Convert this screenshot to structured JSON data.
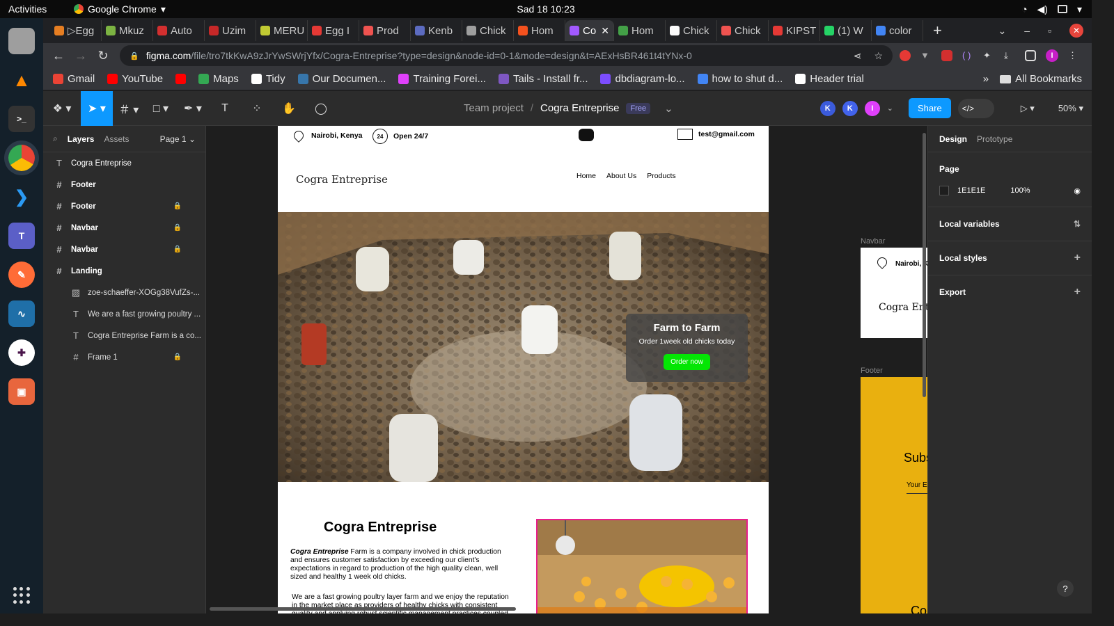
{
  "system": {
    "activities": "Activities",
    "app_name": "Google Chrome",
    "clock": "Sad 18  10:23"
  },
  "dock": [
    "Files",
    "VLC",
    "Terminal",
    "Chrome",
    "VS Code",
    "Teams",
    "Postman",
    "Wireshark",
    "Slack",
    "Impress"
  ],
  "tabs": [
    {
      "label": "▷Egg",
      "color": "#e67e22"
    },
    {
      "label": "Mkuz",
      "color": "#7cb342"
    },
    {
      "label": "Auto",
      "color": "#d32f2f"
    },
    {
      "label": "Uzim",
      "color": "#c62828"
    },
    {
      "label": "MERU",
      "color": "#c0ca33"
    },
    {
      "label": "Egg I",
      "color": "#e53935"
    },
    {
      "label": "Prod",
      "color": "#ef5350"
    },
    {
      "label": "Kenb",
      "color": "#5c6bc0"
    },
    {
      "label": "Chick",
      "color": "#9e9e9e"
    },
    {
      "label": "Hom",
      "color": "#f4511e"
    },
    {
      "label": "Co",
      "color": "#a259ff",
      "active": true
    },
    {
      "label": "Hom",
      "color": "#43a047"
    },
    {
      "label": "Chick",
      "color": "#fafafa"
    },
    {
      "label": "Chick",
      "color": "#ef5350"
    },
    {
      "label": "KIPST",
      "color": "#e53935"
    },
    {
      "label": "(1) W",
      "color": "#25d366"
    },
    {
      "label": "color",
      "color": "#4285f4"
    }
  ],
  "address": {
    "host": "figma.com",
    "path": "/file/tro7tkKwA9zJrYwSWrjYfx/Cogra-Entreprise?type=design&node-id=0-1&mode=design&t=AExHsBR461t4tYNx-0"
  },
  "bookmarks": [
    {
      "label": "Gmail",
      "color": "#ea4335"
    },
    {
      "label": "YouTube",
      "color": "#ff0000"
    },
    {
      "label": "",
      "color": "#ff0000"
    },
    {
      "label": "Maps",
      "color": "#34a853"
    },
    {
      "label": "Tidy",
      "color": "#ffffff"
    },
    {
      "label": "Our Documen...",
      "color": "#3776ab"
    },
    {
      "label": "Training Forei...",
      "color": "#e040fb"
    },
    {
      "label": "Tails - Install fr...",
      "color": "#7e57c2"
    },
    {
      "label": "dbdiagram-lo...",
      "color": "#7c4dff"
    },
    {
      "label": "how to shut d...",
      "color": "#4285f4"
    },
    {
      "label": "Header trial",
      "color": "#ffffff"
    }
  ],
  "bookmarks_all": "All Bookmarks",
  "figma": {
    "team": "Team project",
    "file": "Cogra Entreprise",
    "plan": "Free",
    "avatars": [
      {
        "letter": "K",
        "color": "#3b5bdb"
      },
      {
        "letter": "K",
        "color": "#4263eb"
      },
      {
        "letter": "I",
        "color": "#e040fb"
      }
    ],
    "share": "Share",
    "zoom": "50%"
  },
  "layers_panel": {
    "tab_layers": "Layers",
    "tab_assets": "Assets",
    "page": "Page 1",
    "items": [
      {
        "name": "Cogra Entreprise",
        "icon": "T",
        "level": 0,
        "bold": false,
        "locked": false
      },
      {
        "name": "Footer",
        "icon": "#",
        "level": 0,
        "bold": true,
        "locked": false
      },
      {
        "name": "Footer",
        "icon": "#",
        "level": 0,
        "bold": true,
        "locked": true
      },
      {
        "name": "Navbar",
        "icon": "#",
        "level": 0,
        "bold": true,
        "locked": true
      },
      {
        "name": "Navbar",
        "icon": "#",
        "level": 0,
        "bold": true,
        "locked": true
      },
      {
        "name": "Landing",
        "icon": "#",
        "level": 0,
        "bold": true,
        "locked": false
      },
      {
        "name": "zoe-schaeffer-XOGg38VufZs-...",
        "icon": "▨",
        "level": 1,
        "bold": false,
        "locked": false
      },
      {
        "name": "We are a fast growing poultry ...",
        "icon": "T",
        "level": 1,
        "bold": false,
        "locked": false
      },
      {
        "name": "Cogra Entreprise Farm is a co...",
        "icon": "T",
        "level": 1,
        "bold": false,
        "locked": false
      },
      {
        "name": "Frame 1",
        "icon": "#",
        "level": 1,
        "bold": false,
        "locked": true
      }
    ]
  },
  "canvas": {
    "contact": {
      "location": "Nairobi, Kenya",
      "hours": "Open 24/7",
      "hours_badge": "24",
      "email": "test@gmail.com"
    },
    "brand": "Cogra Entreprise",
    "nav": [
      "Home",
      "About Us",
      "Products"
    ],
    "hero": {
      "title": "Farm to Farm",
      "subtitle": "Order 1week old chicks today",
      "cta": "Order now"
    },
    "about": {
      "title": "Cogra Entreprise",
      "p1_em": "Cogra Entreprise",
      "p1_rest": " Farm is a company involved in chick production and ensures customer satisfaction by exceeding our client's expectations in regard to production of the high quality clean, well sized and healthy 1 week old chicks.",
      "p2": "We are a fast growing poultry layer farm and we enjoy the reputation in the market place as providers of healthy chicks with consistent quality and applying robust scientific management practices coupled"
    },
    "side_navbar_label": "Navbar",
    "side_navbar_location": "Nairobi, K",
    "side_navbar_brand": "Cogra Entre",
    "side_footer_label": "Footer",
    "side_footer_heading": "Subs",
    "side_footer_input": "Your E",
    "side_footer_bottom": "Co"
  },
  "design_panel": {
    "tab_design": "Design",
    "tab_prototype": "Prototype",
    "page_label": "Page",
    "page_color": "1E1E1E",
    "page_opacity": "100%",
    "local_variables": "Local variables",
    "local_styles": "Local styles",
    "export": "Export",
    "help": "?"
  }
}
